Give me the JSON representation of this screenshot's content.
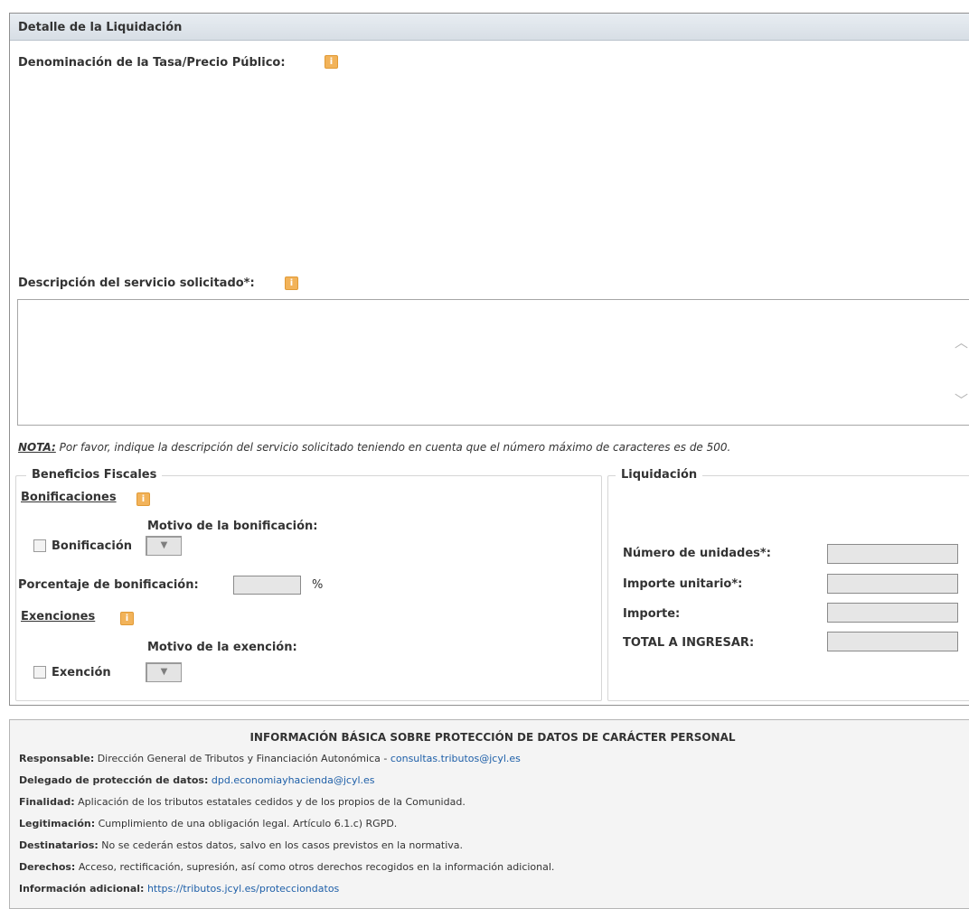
{
  "panel": {
    "title": "Detalle de la Liquidación",
    "denominacion_label": "Denominación de la Tasa/Precio Público:",
    "descripcion_label": "Descripción del servicio solicitado*:",
    "descripcion_value": "",
    "nota_label": "NOTA:",
    "nota_text": " Por favor, indique la descripción del servicio solicitado teniendo en cuenta que el número máximo de caracteres es de 500."
  },
  "beneficios": {
    "legend": "Beneficios Fiscales",
    "bonificaciones_label": "Bonificaciones",
    "motivo_bonificacion_label": "Motivo de la bonificación:",
    "bonificacion_checkbox_label": "Bonificación",
    "porcentaje_label": "Porcentaje de bonificación:",
    "porcentaje_unit": "%",
    "porcentaje_value": "",
    "exenciones_label": "Exenciones",
    "motivo_exencion_label": "Motivo de la exención:",
    "exencion_checkbox_label": "Exención"
  },
  "liquidacion": {
    "legend": "Liquidación",
    "numero_unidades_label": "Número de unidades*:",
    "importe_unitario_label": "Importe unitario*:",
    "importe_label": "Importe:",
    "total_label": "TOTAL A INGRESAR:",
    "numero_unidades_value": "",
    "importe_unitario_value": "",
    "importe_value": "",
    "total_value": ""
  },
  "proteccion": {
    "title": "INFORMACIÓN BÁSICA SOBRE PROTECCIÓN DE DATOS DE CARÁCTER PERSONAL",
    "lines": [
      {
        "label": "Responsable:",
        "text": " Dirección General de Tributos y Financiación Autonómica - ",
        "link": "consultas.tributos@jcyl.es"
      },
      {
        "label": "Delegado de protección de datos:",
        "text": " ",
        "link": "dpd.economiayhacienda@jcyl.es"
      },
      {
        "label": "Finalidad:",
        "text": " Aplicación de los tributos estatales cedidos y de los propios de la Comunidad.",
        "link": ""
      },
      {
        "label": "Legitimación:",
        "text": " Cumplimiento de una obligación legal. Artículo 6.1.c) RGPD.",
        "link": ""
      },
      {
        "label": "Destinatarios:",
        "text": " No se cederán estos datos, salvo en los casos previstos en la normativa.",
        "link": ""
      },
      {
        "label": "Derechos:",
        "text": " Acceso, rectificación, supresión, así como otros derechos recogidos en la información adicional.",
        "link": ""
      },
      {
        "label": "Información adicional:",
        "text": " ",
        "link": "https://tributos.jcyl.es/protecciondatos"
      }
    ]
  },
  "icons": {
    "info": "info-icon",
    "scroll_up": "chevron-up-icon",
    "scroll_down": "chevron-down-icon",
    "dropdown": "chevron-down-icon"
  },
  "colors": {
    "info_icon": "#f2b35a",
    "link": "#1e5fa8",
    "header_bg": "#d7dee5"
  }
}
